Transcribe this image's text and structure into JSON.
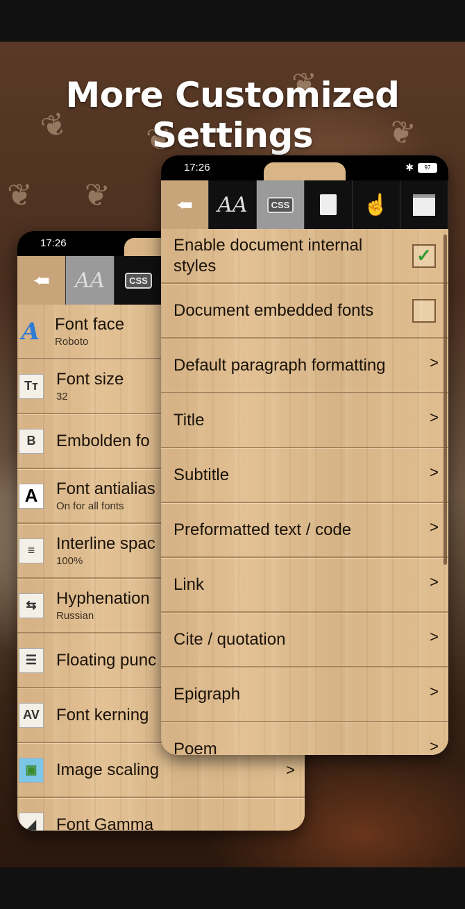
{
  "headline": "More Customized Settings",
  "back_phone": {
    "time": "17:26",
    "toolbar": [
      {
        "name": "back-arrow-icon",
        "glyph": "➨"
      },
      {
        "name": "font-settings-icon",
        "glyph": "AA"
      },
      {
        "name": "css-tab-icon",
        "glyph": "CSS"
      }
    ],
    "items": [
      {
        "icon": "font-face-icon",
        "glyph": "A",
        "title": "Font face",
        "sub": "Roboto",
        "chev": ""
      },
      {
        "icon": "font-size-icon",
        "glyph": "Tт",
        "title": "Font size",
        "sub": "32",
        "chev": ""
      },
      {
        "icon": "embolden-icon",
        "glyph": "B",
        "title": "Embolden fo",
        "sub": "",
        "chev": ""
      },
      {
        "icon": "antialias-icon",
        "glyph": "A",
        "title": "Font antialias",
        "sub": "On for all fonts",
        "chev": ""
      },
      {
        "icon": "interline-icon",
        "glyph": "≡",
        "title": "Interline spac",
        "sub": "100%",
        "chev": ""
      },
      {
        "icon": "hyphenation-icon",
        "glyph": "⇆",
        "title": "Hyphenation",
        "sub": "Russian",
        "chev": ""
      },
      {
        "icon": "floating-punctuation-icon",
        "glyph": "☰",
        "title": "Floating punc",
        "sub": "",
        "chev": ""
      },
      {
        "icon": "kerning-icon",
        "glyph": "AV",
        "title": "Font kerning",
        "sub": "",
        "chev": ""
      },
      {
        "icon": "image-scaling-icon",
        "glyph": "▣",
        "title": "Image scaling",
        "sub": "",
        "chev": ">"
      },
      {
        "icon": "gamma-icon",
        "glyph": "◢",
        "title": "Font Gamma",
        "sub": "",
        "chev": ""
      }
    ]
  },
  "front_phone": {
    "time": "17:26",
    "battery": "97",
    "toolbar": [
      {
        "name": "back-arrow-icon",
        "glyph": "➨"
      },
      {
        "name": "font-settings-icon",
        "glyph": "AA"
      },
      {
        "name": "css-tab-icon",
        "glyph": "CSS"
      },
      {
        "name": "page-icon",
        "glyph": "▯"
      },
      {
        "name": "gesture-icon",
        "glyph": "☝"
      },
      {
        "name": "window-icon",
        "glyph": "▭"
      }
    ],
    "items": [
      {
        "title": "Enable document internal styles",
        "type": "checkbox",
        "checked": true,
        "chev": ""
      },
      {
        "title": "Document embedded fonts",
        "type": "checkbox",
        "checked": false,
        "chev": ""
      },
      {
        "title": "Default paragraph formatting",
        "type": "link",
        "chev": ">"
      },
      {
        "title": "Title",
        "type": "link",
        "chev": ">"
      },
      {
        "title": "Subtitle",
        "type": "link",
        "chev": ">"
      },
      {
        "title": "Preformatted text / code",
        "type": "link",
        "chev": ">"
      },
      {
        "title": "Link",
        "type": "link",
        "chev": ">"
      },
      {
        "title": "Cite / quotation",
        "type": "link",
        "chev": ">"
      },
      {
        "title": "Epigraph",
        "type": "link",
        "chev": ">"
      },
      {
        "title": "Poem",
        "type": "link",
        "chev": ">"
      }
    ]
  }
}
